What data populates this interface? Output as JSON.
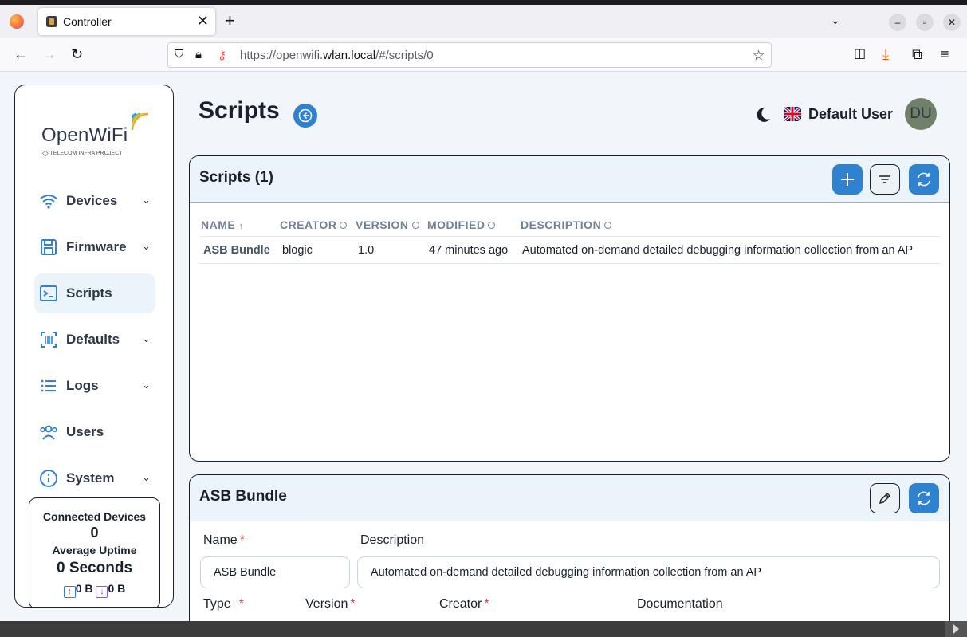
{
  "browser": {
    "tab_title": "Controller",
    "url_prefix": "https://openwifi.",
    "url_domain": "wlan.local",
    "url_suffix": "/#/scripts/0"
  },
  "sidebar": {
    "logo": "OpenWiFi",
    "logo_sub": "TELECOM INFRA PROJECT",
    "items": [
      {
        "label": "Devices",
        "icon": "wifi-icon",
        "has_menu": true
      },
      {
        "label": "Firmware",
        "icon": "floppy-icon",
        "has_menu": true
      },
      {
        "label": "Scripts",
        "icon": "terminal-icon",
        "has_menu": false,
        "active": true
      },
      {
        "label": "Defaults",
        "icon": "barcode-icon",
        "has_menu": true
      },
      {
        "label": "Logs",
        "icon": "list-icon",
        "has_menu": true
      },
      {
        "label": "Users",
        "icon": "users-icon",
        "has_menu": false
      },
      {
        "label": "System",
        "icon": "info-icon",
        "has_menu": true
      }
    ],
    "stats": {
      "connected_label": "Connected Devices",
      "connected_value": "0",
      "uptime_label": "Average Uptime",
      "uptime_value": "0 Seconds",
      "tx": "0 B",
      "rx": "0 B"
    }
  },
  "header": {
    "title": "Scripts",
    "user_name": "Default User",
    "avatar_initials": "DU"
  },
  "scripts_card": {
    "title": "Scripts (1)",
    "columns": [
      "NAME",
      "CREATOR",
      "VERSION",
      "MODIFIED",
      "DESCRIPTION"
    ],
    "rows": [
      {
        "name": "ASB Bundle",
        "creator": "blogic",
        "version": "1.0",
        "modified": "47 minutes ago",
        "description": "Automated on-demand detailed debugging information collection from an AP"
      }
    ]
  },
  "detail_card": {
    "title": "ASB Bundle",
    "fields": {
      "name_label": "Name",
      "name_value": "ASB Bundle",
      "description_label": "Description",
      "description_value": "Automated on-demand detailed debugging information collection from an AP",
      "type_label": "Type",
      "version_label": "Version",
      "creator_label": "Creator",
      "documentation_label": "Documentation"
    }
  },
  "colors": {
    "accent": "#3182ce",
    "header_bg": "#ebf4fb",
    "required": "#e53e3e"
  }
}
